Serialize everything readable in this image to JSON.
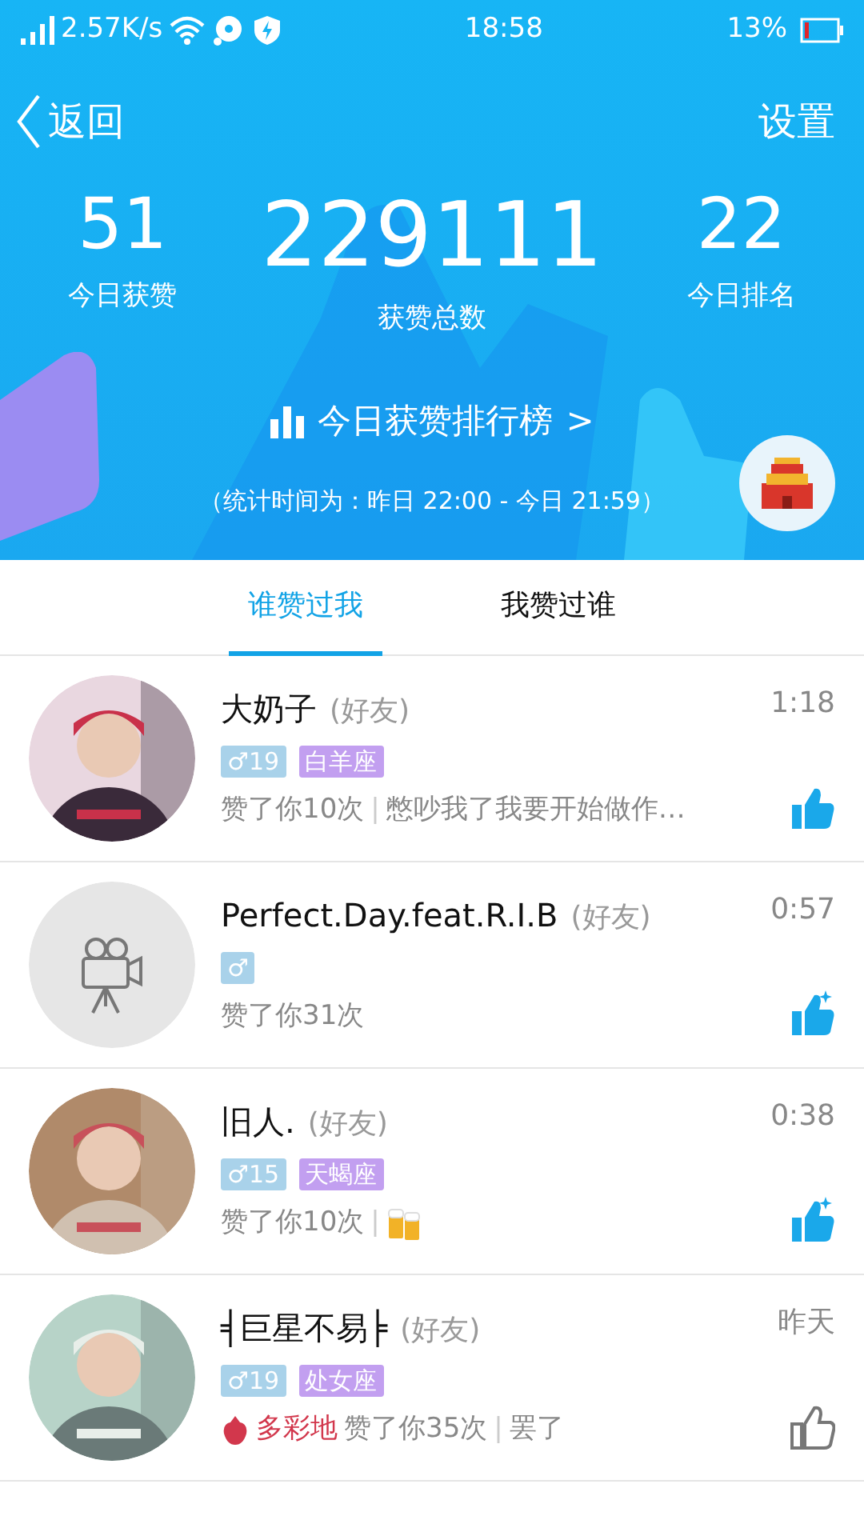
{
  "status_bar": {
    "speed": "2.57K/s",
    "time": "18:58",
    "battery_text": "13%",
    "battery": {
      "level": 0.13
    }
  },
  "nav": {
    "back": "返回",
    "settings": "设置"
  },
  "stats": [
    {
      "value": "51",
      "label": "今日获赞",
      "kind": "side"
    },
    {
      "value": "229111",
      "label": "获赞总数",
      "kind": "main"
    },
    {
      "value": "22",
      "label": "今日排名",
      "kind": "side"
    }
  ],
  "ranking_link": "今日获赞排行榜",
  "ranking_arrow": ">",
  "stats_period": "（统计时间为：昨日 22:00 - 今日 21:59）",
  "tabs": [
    {
      "label": "谁赞过我",
      "selected": true
    },
    {
      "label": "我赞过谁",
      "selected": false
    }
  ],
  "users": [
    {
      "name": "大奶子",
      "relation": "(好友)",
      "time": "1:18",
      "gender": "♂",
      "age": "19",
      "zodiac": "白羊座",
      "note": "赞了你10次",
      "separator": "|",
      "status": "憋吵我了我要开始做作…",
      "liked_back": true,
      "sparkle": false
    },
    {
      "name": "Perfect.Day.feat.R.I.B",
      "relation": "(好友)",
      "time": "0:57",
      "avatar": {
        "kind": "camera"
      },
      "gender": "♂",
      "note": "赞了你31次",
      "liked_back": true,
      "sparkle": true
    },
    {
      "name": "旧人.",
      "relation": "(好友)",
      "time": "0:38",
      "gender": "♂",
      "age": "15",
      "zodiac": "天蝎座",
      "note": "赞了你10次",
      "separator": "|",
      "status_icon": {
        "kind": "beer"
      },
      "liked_back": true,
      "sparkle": true
    },
    {
      "name": "╡巨星不易╞",
      "relation": "(好友)",
      "time": "昨天",
      "gender": "♂",
      "age": "19",
      "zodiac": "处女座",
      "badge_name": "多彩地",
      "note": "赞了你35次",
      "separator": "|",
      "status": "罢了",
      "liked_back": false,
      "sparkle": false
    }
  ]
}
